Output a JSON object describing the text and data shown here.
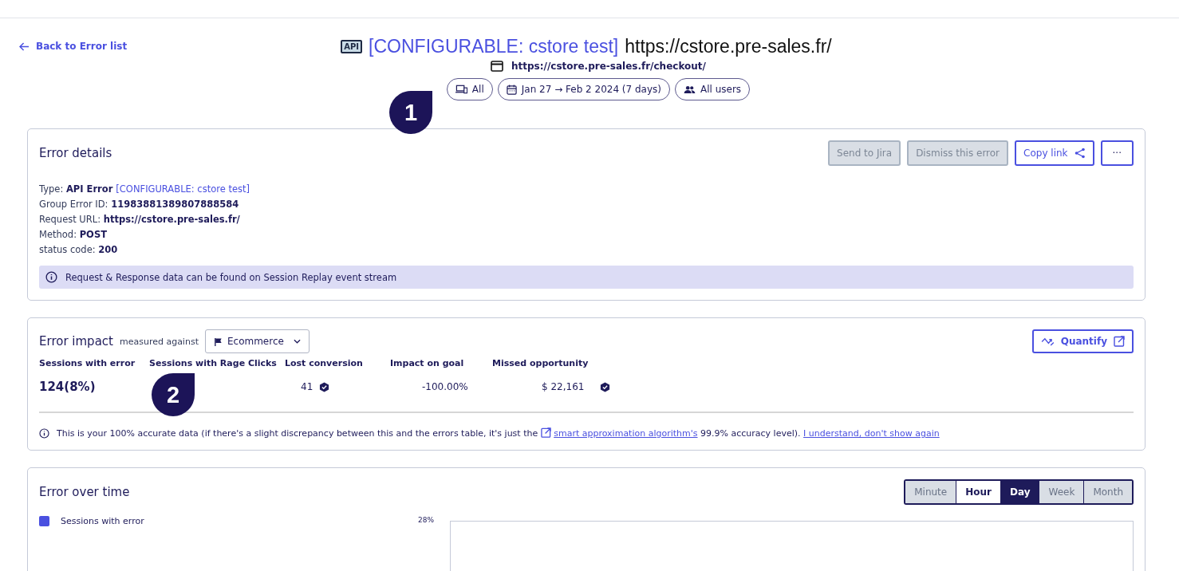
{
  "back_link": "Back to Error list",
  "header": {
    "badge": "API",
    "title": "[CONFIGURABLE: cstore test]",
    "url": "https://cstore.pre-sales.fr/",
    "page_url": "https://cstore.pre-sales.fr/checkout/"
  },
  "filters": [
    {
      "kind": "device",
      "label": "All"
    },
    {
      "kind": "date",
      "label": "Jan 27 → Feb 2 2024 (7 days)"
    },
    {
      "kind": "users",
      "label": "All users"
    }
  ],
  "callouts": [
    "1",
    "2"
  ],
  "error_details": {
    "title": "Error details",
    "actions": [
      {
        "kind": "plain",
        "label": "Send to Jira",
        "disabled": true
      },
      {
        "kind": "plain",
        "label": "Dismiss this error",
        "disabled": true
      },
      {
        "kind": "share",
        "label": "Copy link",
        "disabled": false
      },
      {
        "kind": "more",
        "label": "···",
        "disabled": false
      }
    ],
    "fields": [
      {
        "label": "Type:",
        "value": "API Error",
        "tag": "[CONFIGURABLE: cstore test]"
      },
      {
        "label": "Group Error ID:",
        "value": "11983881389807888584"
      },
      {
        "label": "Request URL:",
        "value": "https://cstore.pre-sales.fr/"
      },
      {
        "label": "Method:",
        "value": "POST"
      },
      {
        "label": "status code:",
        "value": "200"
      }
    ],
    "info": "Request & Response data can be found on Session Replay event stream"
  },
  "error_impact": {
    "title": "Error impact",
    "measured": "measured against",
    "goal": "Ecommerce",
    "quantify": "Quantify",
    "metrics": [
      {
        "label": "Sessions with error",
        "value": "124(8%)",
        "verified": false
      },
      {
        "label": "Sessions with Rage Clicks",
        "verified": false
      },
      {
        "label": "Lost conversion",
        "value": "41",
        "verified": true
      },
      {
        "label": "Impact on goal",
        "value": "-100.00%",
        "verified": false
      },
      {
        "label": "Missed opportunity",
        "value": "$ 22,161",
        "verified": true
      }
    ],
    "note": {
      "before": "This is your 100% accurate data (if there's a slight discrepancy between this and the errors table, it's just the",
      "link": "smart approximation algorithm's",
      "after": "99.9% accuracy level).",
      "dismiss": "I understand, don't show again"
    }
  },
  "error_over_time": {
    "title": "Error over time",
    "granularity": [
      {
        "label": "Minute",
        "selected": false,
        "disabled": true
      },
      {
        "label": "Hour",
        "selected": false,
        "disabled": false
      },
      {
        "label": "Day",
        "selected": true,
        "disabled": false
      },
      {
        "label": "Week",
        "selected": false,
        "disabled": true
      },
      {
        "label": "Month",
        "selected": false,
        "disabled": true
      }
    ],
    "legend": "Sessions with error",
    "y_tick": "28%"
  }
}
